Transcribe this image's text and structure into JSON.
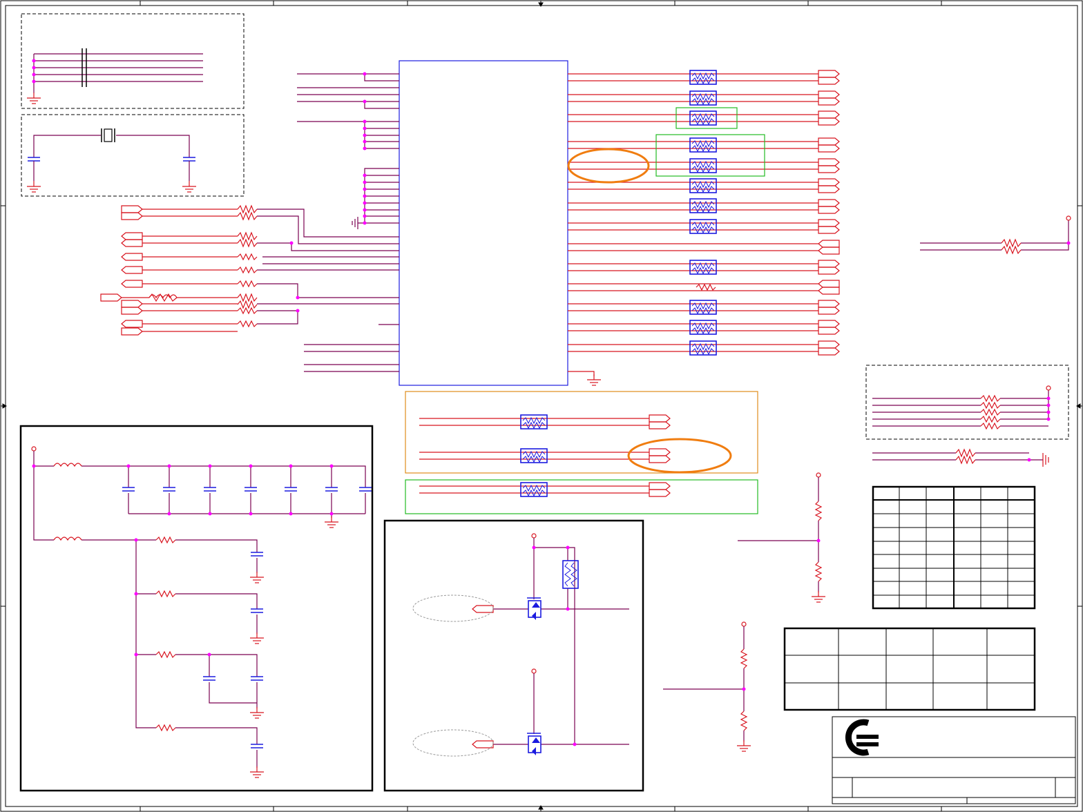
{
  "sheet": {
    "kind": "electrical schematic sheet (no legible text)",
    "colors": {
      "frame": "#000000",
      "wire": "#7a0050",
      "net_red": "#d8141f",
      "component": "#1a1adf",
      "junction": "#ff00ff",
      "box_orange": "#e08c1a",
      "box_green": "#22bb22",
      "highlight_ellipse": "#f07d10",
      "title_logo": "#000000"
    }
  },
  "blocks": [
    {
      "id": "decoupling-block",
      "label": ""
    },
    {
      "id": "crystal-block",
      "label": ""
    },
    {
      "id": "main-ic",
      "label": ""
    },
    {
      "id": "right-resistor-block",
      "label": ""
    },
    {
      "id": "orange-group",
      "label": ""
    },
    {
      "id": "green-group",
      "label": ""
    },
    {
      "id": "power-filter-block",
      "label": ""
    },
    {
      "id": "mosfet-block",
      "label": ""
    }
  ],
  "title_block": {
    "logo": "c-equals-logo",
    "company": "",
    "title": "",
    "sheet_number": ""
  },
  "revision_table": {
    "rows": 8,
    "cols": 6
  },
  "signature_table": {
    "rows": 3,
    "cols": 5
  }
}
